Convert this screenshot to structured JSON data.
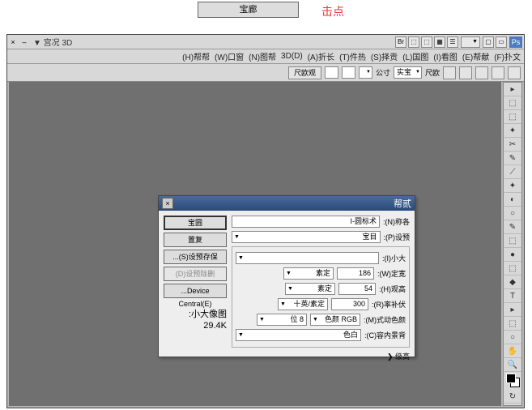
{
  "outside": {
    "button": "宝廊",
    "label": "击点"
  },
  "titlebar": {
    "left_text": "宫况 3D ▼",
    "dropdown": "",
    "x": "×",
    "min": "–"
  },
  "menus": [
    "(F)扑文",
    "(E)帮献",
    "(I)看图",
    "(L)国图",
    "(S)择贡",
    "(T)件热",
    "(A)折长",
    "3D(D)",
    "(N)图帮",
    "(W)口窗",
    "(H)帮帮"
  ],
  "optbar": {
    "btn": "尺欧观",
    "fields": [
      "",
      "",
      "",
      "实宝"
    ],
    "labels": [
      "公寸",
      "尺欧"
    ]
  },
  "tools": [
    "▸",
    "⬚",
    "⬚",
    "✦",
    "✂",
    "✎",
    "⟋",
    "✦",
    "◐",
    "○",
    "✎",
    "⬚",
    "●",
    "⬚",
    "◆",
    "✎",
    "T",
    "▸",
    "⬚",
    "○",
    "✋",
    "🔍",
    "↻"
  ],
  "dialog": {
    "title": "帮贰",
    "name_label": ":(N)称各",
    "name_value": "I-圆标术",
    "preset_label": ":(P)设预",
    "preset_value": "宝目",
    "size_label": ":(I)小大",
    "width_label": ":(W)定宽",
    "width_value": "186",
    "width_unit": "素定",
    "height_label": ":(H)观高",
    "height_value": "54",
    "height_unit": "素定",
    "res_label": ":(R)率补伏",
    "res_value": "300",
    "res_unit": "十英/素定",
    "mode_label": ":(M)式动色颜",
    "mode_value": "色颜 RGB",
    "mode_bits": "位 8",
    "bg_label": ":(C)容内景背",
    "bg_value": "色白",
    "advanced": "级高",
    "buttons": {
      "ok": "宝圆",
      "reset": "置复",
      "save_preset": "...(S)设预存保",
      "del_preset": "(D)设预除删",
      "device": "...Device Central(E)"
    },
    "info_label": ":小大像图",
    "info_value": "29.4K"
  }
}
